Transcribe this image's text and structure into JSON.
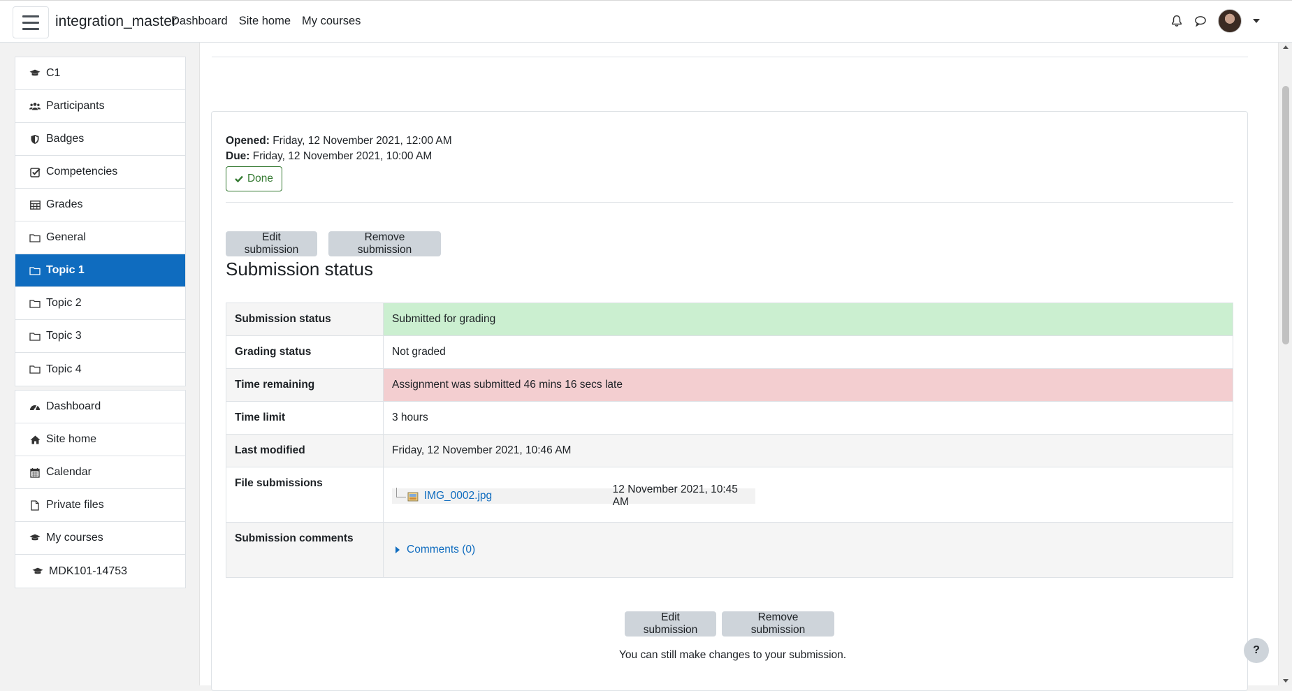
{
  "navbar": {
    "site_name": "integration_master",
    "links": [
      "Dashboard",
      "Site home",
      "My courses"
    ]
  },
  "drawer": {
    "course_items": [
      {
        "label": "C1",
        "icon": "graduation-cap-icon"
      },
      {
        "label": "Participants",
        "icon": "users-icon"
      },
      {
        "label": "Badges",
        "icon": "shield-icon"
      },
      {
        "label": "Competencies",
        "icon": "check-square-icon"
      },
      {
        "label": "Grades",
        "icon": "table-icon"
      },
      {
        "label": "General",
        "icon": "folder-icon"
      },
      {
        "label": "Topic 1",
        "icon": "folder-icon",
        "active": true
      },
      {
        "label": "Topic 2",
        "icon": "folder-icon"
      },
      {
        "label": "Topic 3",
        "icon": "folder-icon"
      },
      {
        "label": "Topic 4",
        "icon": "folder-icon"
      }
    ],
    "site_items": [
      {
        "label": "Dashboard",
        "icon": "tachometer-icon"
      },
      {
        "label": "Site home",
        "icon": "home-icon"
      },
      {
        "label": "Calendar",
        "icon": "calendar-icon"
      },
      {
        "label": "Private files",
        "icon": "file-icon"
      },
      {
        "label": "My courses",
        "icon": "graduation-cap-icon"
      },
      {
        "label": "MDK101-14753",
        "icon": "graduation-cap-icon"
      }
    ]
  },
  "dates": {
    "opened_label": "Opened:",
    "opened_value": "Friday, 12 November 2021, 12:00 AM",
    "due_label": "Due:",
    "due_value": "Friday, 12 November 2021, 10:00 AM"
  },
  "done_label": "Done",
  "buttons": {
    "edit_submission": "Edit submission",
    "remove_submission": "Remove submission"
  },
  "section_title": "Submission status",
  "status_table": {
    "submission_status": {
      "label": "Submission status",
      "value": "Submitted for grading"
    },
    "grading_status": {
      "label": "Grading status",
      "value": "Not graded"
    },
    "time_remaining": {
      "label": "Time remaining",
      "value": "Assignment was submitted 46 mins 16 secs late"
    },
    "time_limit": {
      "label": "Time limit",
      "value": "3 hours"
    },
    "last_modified": {
      "label": "Last modified",
      "value": "Friday, 12 November 2021, 10:46 AM"
    },
    "file_submissions": {
      "label": "File submissions",
      "file_name": "IMG_0002.jpg",
      "file_date": "12 November 2021, 10:45 AM"
    },
    "submission_comments": {
      "label": "Submission comments",
      "value": "Comments (0)"
    }
  },
  "note": "You can still make changes to your submission.",
  "help_label": "?",
  "colors": {
    "primary": "#0f6cbf",
    "success_bg": "#cbefd0",
    "danger_bg": "#f3ced0",
    "done_green": "#357a32"
  }
}
